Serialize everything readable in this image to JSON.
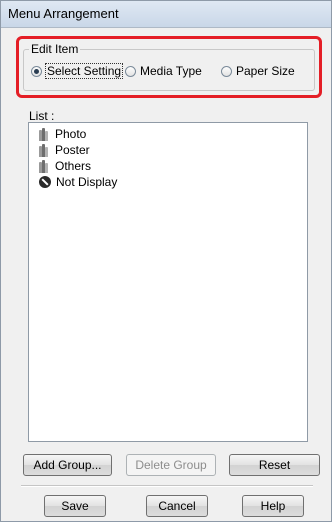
{
  "window": {
    "title": "Menu Arrangement"
  },
  "edit_item": {
    "label": "Edit Item",
    "options": [
      {
        "label": "Select Setting",
        "checked": true
      },
      {
        "label": "Media Type",
        "checked": false
      },
      {
        "label": "Paper Size",
        "checked": false
      }
    ]
  },
  "list": {
    "label": "List :",
    "items": [
      {
        "label": "Photo",
        "icon": "folder-icon"
      },
      {
        "label": "Poster",
        "icon": "folder-icon"
      },
      {
        "label": "Others",
        "icon": "folder-icon"
      },
      {
        "label": "Not Display",
        "icon": "not-display-icon"
      }
    ]
  },
  "buttons": {
    "add_group": "Add Group...",
    "delete_group": "Delete Group",
    "reset": "Reset",
    "save": "Save",
    "cancel": "Cancel",
    "help": "Help"
  },
  "colors": {
    "highlight_border": "#e41e26"
  }
}
